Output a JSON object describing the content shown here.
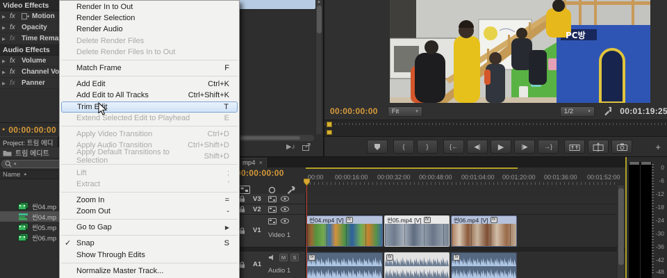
{
  "glyphs": {
    "check": "✓",
    "submenu": "▶",
    "close": "×",
    "dropdown": "▾",
    "disclosure": "▶",
    "sort": "▲",
    "dot": "●",
    "plus": "+",
    "marker": "▼",
    "mark_in": "{",
    "mark_out": "}",
    "go_in": "{←",
    "step_back": "◀|",
    "play": "▶",
    "step_fwd": "|▶",
    "go_out": "→}",
    "note": "♪"
  },
  "effect_controls": {
    "video_header": "Video Effects",
    "audio_header": "Audio Effects",
    "fx": "fx",
    "rows": [
      {
        "name": "Motion"
      },
      {
        "name": "Opacity"
      },
      {
        "name": "Time Remapping"
      },
      {
        "name": "Volume"
      },
      {
        "name": "Channel Volume"
      },
      {
        "name": "Panner"
      }
    ],
    "timecode": "00:00:00:00"
  },
  "project": {
    "tab": "Project: 트림 에디",
    "bin": "트림 에디트",
    "column": "Name",
    "items": [
      {
        "label": "씬04.mp"
      },
      {
        "label": "씬04.mp"
      },
      {
        "label": "씬05.mp"
      },
      {
        "label": "씬06.mp"
      }
    ]
  },
  "menu": {
    "items": [
      {
        "label": "Render In to Out",
        "shortcut": ""
      },
      {
        "label": "Render Selection",
        "shortcut": ""
      },
      {
        "label": "Render Audio",
        "shortcut": ""
      },
      {
        "label": "Delete Render Files",
        "shortcut": "",
        "disabled": true
      },
      {
        "label": "Delete Render Files In to Out",
        "shortcut": "",
        "disabled": true
      },
      {
        "label": "Match Frame",
        "shortcut": "F"
      },
      {
        "label": "Add Edit",
        "shortcut": "Ctrl+K"
      },
      {
        "label": "Add Edit to All Tracks",
        "shortcut": "Ctrl+Shift+K"
      },
      {
        "label": "Trim Edit",
        "shortcut": "T",
        "highlighted": true
      },
      {
        "label": "Extend Selected Edit to Playhead",
        "shortcut": "E",
        "disabled": true
      },
      {
        "label": "Apply Video Transition",
        "shortcut": "Ctrl+D",
        "disabled": true
      },
      {
        "label": "Apply Audio Transition",
        "shortcut": "Ctrl+Shift+D",
        "disabled": true
      },
      {
        "label": "Apply Default Transitions to Selection",
        "shortcut": "Shift+D",
        "disabled": true
      },
      {
        "label": "Lift",
        "shortcut": ";",
        "disabled": true
      },
      {
        "label": "Extract",
        "shortcut": "'",
        "disabled": true
      },
      {
        "label": "Zoom In",
        "shortcut": "="
      },
      {
        "label": "Zoom Out",
        "shortcut": "-"
      },
      {
        "label": "Go to Gap",
        "submenu": true
      },
      {
        "label": "Snap",
        "shortcut": "S",
        "checked": true
      },
      {
        "label": "Show Through Edits",
        "shortcut": ""
      },
      {
        "label": "Normalize Master Track...",
        "shortcut": ""
      }
    ]
  },
  "monitor": {
    "timecode": "00:00:00:00",
    "zoom_level": "Fit",
    "resolution": "1/2",
    "duration": "00:01:19:25"
  },
  "timeline": {
    "tab": "mp4",
    "timecode": "00:00:00:00",
    "fx": "fx",
    "ruler": [
      "00:00",
      "00:00:16:00",
      "00:00:32:00",
      "00:00:48:00",
      "00:01:04:00",
      "00:01:20:00",
      "00:01:36:00",
      "00:01:52:00"
    ],
    "tracks": {
      "v3": "V3",
      "v2": "V2",
      "v1": "V1",
      "a1": "A1",
      "video1": "Video 1",
      "audio1": "Audio 1",
      "mute": "M",
      "solo": "S"
    },
    "clips": [
      {
        "name": "씬04.mp4",
        "tag": "[V]"
      },
      {
        "name": "씬05.mp4",
        "tag": "[V]"
      },
      {
        "name": "씬06.mp4",
        "tag": "[V]"
      }
    ]
  },
  "meter": {
    "ticks": [
      "0",
      "-6",
      "-12",
      "-18",
      "-24",
      "-30",
      "-36",
      "-42",
      "-48"
    ]
  }
}
